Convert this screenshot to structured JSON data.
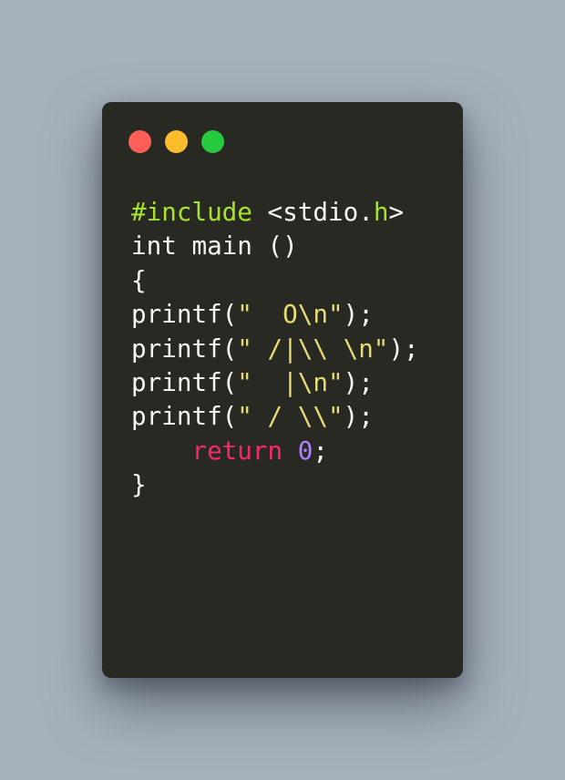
{
  "window": {
    "buttons": [
      {
        "name": "close",
        "color": "#ff5f56"
      },
      {
        "name": "minimize",
        "color": "#ffbd2e"
      },
      {
        "name": "maximize",
        "color": "#27c93f"
      }
    ]
  },
  "colors": {
    "background": "#a7b1bd",
    "editor": "#282923",
    "plain": "#f8f8f2",
    "keyword": "#a6e22e",
    "string": "#e6db74",
    "control": "#f92672",
    "number": "#ae81ff"
  },
  "code": {
    "lines": [
      [
        {
          "t": "#include",
          "c": "keyword"
        },
        {
          "t": " <stdio.",
          "c": "plain"
        },
        {
          "t": "h",
          "c": "keyword"
        },
        {
          "t": ">",
          "c": "plain"
        }
      ],
      [
        {
          "t": "int main ()",
          "c": "plain"
        }
      ],
      [
        {
          "t": "{",
          "c": "plain"
        }
      ],
      [
        {
          "t": "printf(",
          "c": "plain"
        },
        {
          "t": "\"  O\\n\"",
          "c": "string"
        },
        {
          "t": ");",
          "c": "plain"
        }
      ],
      [
        {
          "t": "printf(",
          "c": "plain"
        },
        {
          "t": "\" /|\\\\ \\n\"",
          "c": "string"
        },
        {
          "t": ");",
          "c": "plain"
        }
      ],
      [
        {
          "t": "printf(",
          "c": "plain"
        },
        {
          "t": "\"  |\\n\"",
          "c": "string"
        },
        {
          "t": ");",
          "c": "plain"
        }
      ],
      [
        {
          "t": "printf(",
          "c": "plain"
        },
        {
          "t": "\" / \\\\\"",
          "c": "string"
        },
        {
          "t": ");",
          "c": "plain"
        }
      ],
      [
        {
          "t": "    ",
          "c": "plain"
        },
        {
          "t": "return",
          "c": "control"
        },
        {
          "t": " ",
          "c": "plain"
        },
        {
          "t": "0",
          "c": "number"
        },
        {
          "t": ";",
          "c": "plain"
        }
      ],
      [
        {
          "t": "}",
          "c": "plain"
        }
      ]
    ]
  }
}
